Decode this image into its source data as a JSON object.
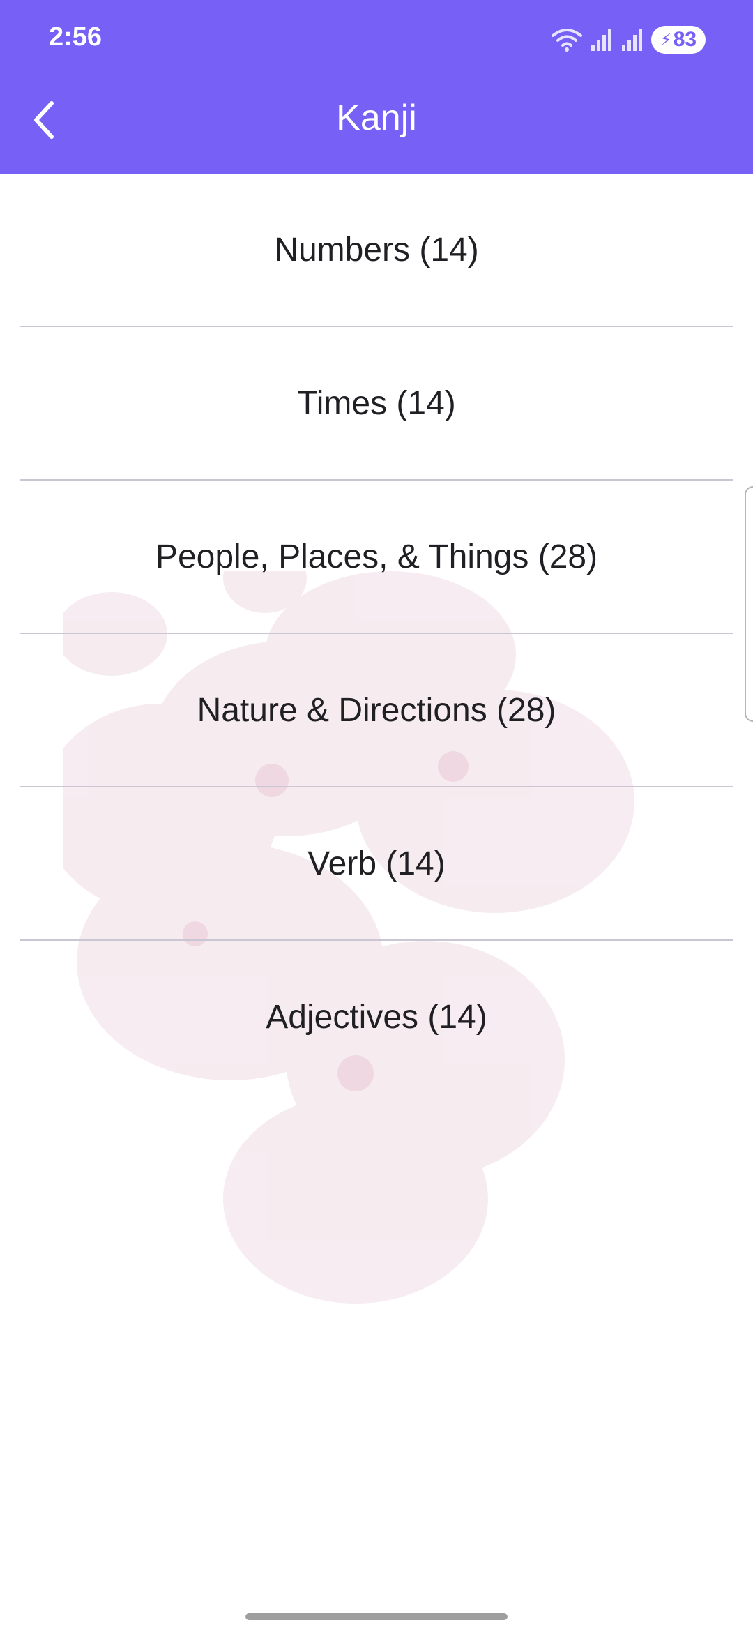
{
  "status_bar": {
    "time": "2:56",
    "battery": "83",
    "icons": [
      "wifi-icon",
      "signal-icon",
      "signal-icon",
      "battery-charging-icon"
    ]
  },
  "header": {
    "title": "Kanji",
    "back_icon": "chevron-left-icon"
  },
  "categories": [
    {
      "label": "Numbers (14)"
    },
    {
      "label": "Times (14)"
    },
    {
      "label": "People, Places, & Things (28)"
    },
    {
      "label": "Nature & Directions (28)"
    },
    {
      "label": "Verb (14)"
    },
    {
      "label": "Adjectives (14)"
    }
  ],
  "colors": {
    "header": "#7660f5",
    "text": "#1f1f24",
    "divider": "#cbc6d4",
    "background": "#ffffff"
  }
}
